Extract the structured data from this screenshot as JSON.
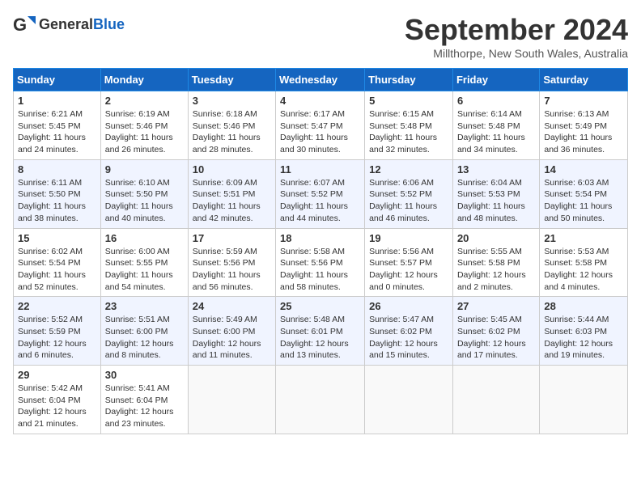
{
  "header": {
    "logo_general": "General",
    "logo_blue": "Blue",
    "month": "September 2024",
    "location": "Millthorpe, New South Wales, Australia"
  },
  "weekdays": [
    "Sunday",
    "Monday",
    "Tuesday",
    "Wednesday",
    "Thursday",
    "Friday",
    "Saturday"
  ],
  "weeks": [
    [
      {
        "day": "1",
        "lines": [
          "Sunrise: 6:21 AM",
          "Sunset: 5:45 PM",
          "Daylight: 11 hours",
          "and 24 minutes."
        ]
      },
      {
        "day": "2",
        "lines": [
          "Sunrise: 6:19 AM",
          "Sunset: 5:46 PM",
          "Daylight: 11 hours",
          "and 26 minutes."
        ]
      },
      {
        "day": "3",
        "lines": [
          "Sunrise: 6:18 AM",
          "Sunset: 5:46 PM",
          "Daylight: 11 hours",
          "and 28 minutes."
        ]
      },
      {
        "day": "4",
        "lines": [
          "Sunrise: 6:17 AM",
          "Sunset: 5:47 PM",
          "Daylight: 11 hours",
          "and 30 minutes."
        ]
      },
      {
        "day": "5",
        "lines": [
          "Sunrise: 6:15 AM",
          "Sunset: 5:48 PM",
          "Daylight: 11 hours",
          "and 32 minutes."
        ]
      },
      {
        "day": "6",
        "lines": [
          "Sunrise: 6:14 AM",
          "Sunset: 5:48 PM",
          "Daylight: 11 hours",
          "and 34 minutes."
        ]
      },
      {
        "day": "7",
        "lines": [
          "Sunrise: 6:13 AM",
          "Sunset: 5:49 PM",
          "Daylight: 11 hours",
          "and 36 minutes."
        ]
      }
    ],
    [
      {
        "day": "8",
        "lines": [
          "Sunrise: 6:11 AM",
          "Sunset: 5:50 PM",
          "Daylight: 11 hours",
          "and 38 minutes."
        ]
      },
      {
        "day": "9",
        "lines": [
          "Sunrise: 6:10 AM",
          "Sunset: 5:50 PM",
          "Daylight: 11 hours",
          "and 40 minutes."
        ]
      },
      {
        "day": "10",
        "lines": [
          "Sunrise: 6:09 AM",
          "Sunset: 5:51 PM",
          "Daylight: 11 hours",
          "and 42 minutes."
        ]
      },
      {
        "day": "11",
        "lines": [
          "Sunrise: 6:07 AM",
          "Sunset: 5:52 PM",
          "Daylight: 11 hours",
          "and 44 minutes."
        ]
      },
      {
        "day": "12",
        "lines": [
          "Sunrise: 6:06 AM",
          "Sunset: 5:52 PM",
          "Daylight: 11 hours",
          "and 46 minutes."
        ]
      },
      {
        "day": "13",
        "lines": [
          "Sunrise: 6:04 AM",
          "Sunset: 5:53 PM",
          "Daylight: 11 hours",
          "and 48 minutes."
        ]
      },
      {
        "day": "14",
        "lines": [
          "Sunrise: 6:03 AM",
          "Sunset: 5:54 PM",
          "Daylight: 11 hours",
          "and 50 minutes."
        ]
      }
    ],
    [
      {
        "day": "15",
        "lines": [
          "Sunrise: 6:02 AM",
          "Sunset: 5:54 PM",
          "Daylight: 11 hours",
          "and 52 minutes."
        ]
      },
      {
        "day": "16",
        "lines": [
          "Sunrise: 6:00 AM",
          "Sunset: 5:55 PM",
          "Daylight: 11 hours",
          "and 54 minutes."
        ]
      },
      {
        "day": "17",
        "lines": [
          "Sunrise: 5:59 AM",
          "Sunset: 5:56 PM",
          "Daylight: 11 hours",
          "and 56 minutes."
        ]
      },
      {
        "day": "18",
        "lines": [
          "Sunrise: 5:58 AM",
          "Sunset: 5:56 PM",
          "Daylight: 11 hours",
          "and 58 minutes."
        ]
      },
      {
        "day": "19",
        "lines": [
          "Sunrise: 5:56 AM",
          "Sunset: 5:57 PM",
          "Daylight: 12 hours",
          "and 0 minutes."
        ]
      },
      {
        "day": "20",
        "lines": [
          "Sunrise: 5:55 AM",
          "Sunset: 5:58 PM",
          "Daylight: 12 hours",
          "and 2 minutes."
        ]
      },
      {
        "day": "21",
        "lines": [
          "Sunrise: 5:53 AM",
          "Sunset: 5:58 PM",
          "Daylight: 12 hours",
          "and 4 minutes."
        ]
      }
    ],
    [
      {
        "day": "22",
        "lines": [
          "Sunrise: 5:52 AM",
          "Sunset: 5:59 PM",
          "Daylight: 12 hours",
          "and 6 minutes."
        ]
      },
      {
        "day": "23",
        "lines": [
          "Sunrise: 5:51 AM",
          "Sunset: 6:00 PM",
          "Daylight: 12 hours",
          "and 8 minutes."
        ]
      },
      {
        "day": "24",
        "lines": [
          "Sunrise: 5:49 AM",
          "Sunset: 6:00 PM",
          "Daylight: 12 hours",
          "and 11 minutes."
        ]
      },
      {
        "day": "25",
        "lines": [
          "Sunrise: 5:48 AM",
          "Sunset: 6:01 PM",
          "Daylight: 12 hours",
          "and 13 minutes."
        ]
      },
      {
        "day": "26",
        "lines": [
          "Sunrise: 5:47 AM",
          "Sunset: 6:02 PM",
          "Daylight: 12 hours",
          "and 15 minutes."
        ]
      },
      {
        "day": "27",
        "lines": [
          "Sunrise: 5:45 AM",
          "Sunset: 6:02 PM",
          "Daylight: 12 hours",
          "and 17 minutes."
        ]
      },
      {
        "day": "28",
        "lines": [
          "Sunrise: 5:44 AM",
          "Sunset: 6:03 PM",
          "Daylight: 12 hours",
          "and 19 minutes."
        ]
      }
    ],
    [
      {
        "day": "29",
        "lines": [
          "Sunrise: 5:42 AM",
          "Sunset: 6:04 PM",
          "Daylight: 12 hours",
          "and 21 minutes."
        ]
      },
      {
        "day": "30",
        "lines": [
          "Sunrise: 5:41 AM",
          "Sunset: 6:04 PM",
          "Daylight: 12 hours",
          "and 23 minutes."
        ]
      },
      {
        "day": "",
        "lines": []
      },
      {
        "day": "",
        "lines": []
      },
      {
        "day": "",
        "lines": []
      },
      {
        "day": "",
        "lines": []
      },
      {
        "day": "",
        "lines": []
      }
    ]
  ]
}
